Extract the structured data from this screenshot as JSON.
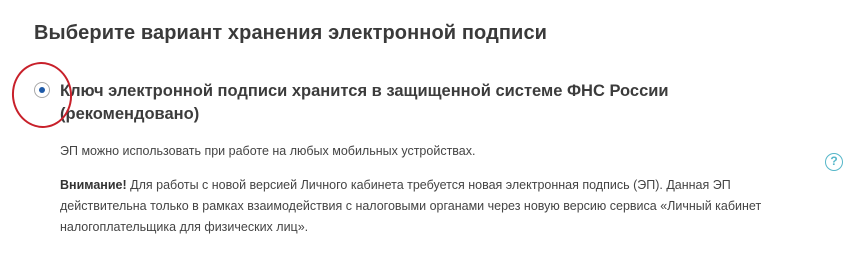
{
  "page": {
    "title": "Выберите вариант хранения электронной подписи"
  },
  "option": {
    "label": "Ключ электронной подписи хранится в защищенной системе ФНС России (рекомендовано)",
    "selected": true,
    "description": "ЭП можно использовать при работе на любых мобильных устройствах."
  },
  "warning": {
    "title": "Внимание!",
    "text": " Для работы с новой версией Личного кабинета требуется новая электронная подпись (ЭП). Данная ЭП действительна только в рамках взаимодействия с налоговыми органами через новую версию сервиса «Личный кабинет налогоплательщика для физических лиц»."
  },
  "help": {
    "icon": "help-icon",
    "glyph": "?"
  },
  "colors": {
    "radio_dot": "#1e5aa8",
    "highlight_circle": "#c8202a",
    "help_icon": "#56b7c9"
  }
}
